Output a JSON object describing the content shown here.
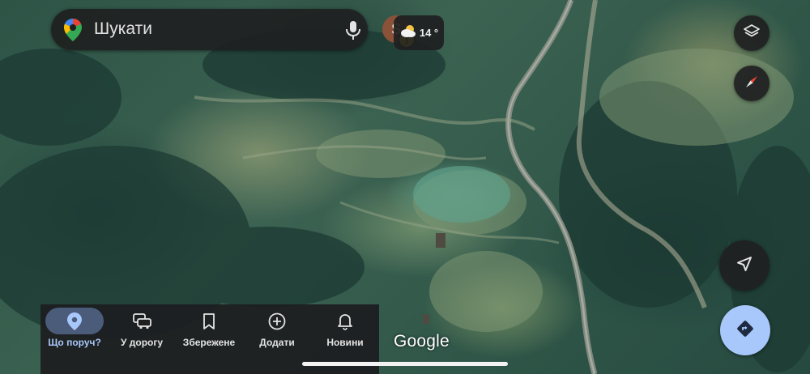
{
  "search": {
    "placeholder": "Шукати",
    "avatar_letter": "S",
    "badge": "!"
  },
  "weather": {
    "temperature": "14 °",
    "icon": "partly-cloudy-icon"
  },
  "map_controls": {
    "layers_icon": "layers-icon",
    "compass_icon": "compass-icon",
    "locate_icon": "navigation-arrow-icon",
    "directions_icon": "directions-icon"
  },
  "bottom_nav": {
    "items": [
      {
        "label": "Що поруч?",
        "icon": "location-pin-icon",
        "active": true
      },
      {
        "label": "У дорогу",
        "icon": "car-icon",
        "active": false
      },
      {
        "label": "Збережене",
        "icon": "bookmark-icon",
        "active": false
      },
      {
        "label": "Додати",
        "icon": "add-circle-icon",
        "active": false
      },
      {
        "label": "Новини",
        "icon": "bell-icon",
        "active": false
      }
    ]
  },
  "map": {
    "attribution": "Google"
  },
  "colors": {
    "accent": "#a8c7fa",
    "panel": "#1e1f21",
    "active_chip": "#4b5c7a"
  }
}
